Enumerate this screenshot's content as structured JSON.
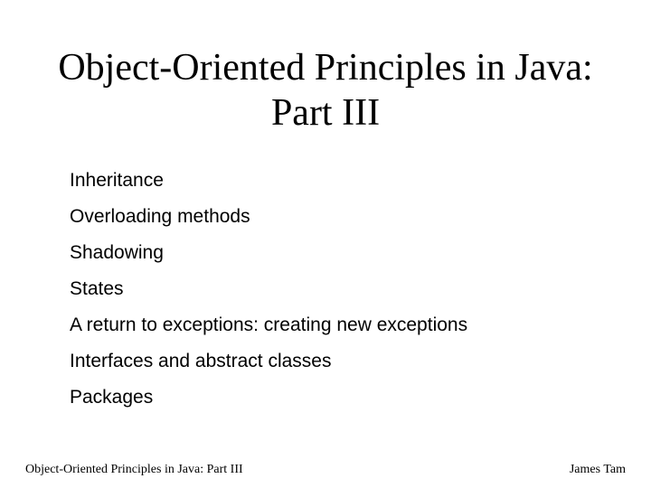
{
  "title": "Object-Oriented Principles in Java: Part III",
  "items": [
    "Inheritance",
    "Overloading methods",
    "Shadowing",
    "States",
    "A return to exceptions: creating new exceptions",
    "Interfaces and abstract classes",
    "Packages"
  ],
  "footer": {
    "left": "Object-Oriented Principles in Java: Part III",
    "right": "James Tam"
  }
}
